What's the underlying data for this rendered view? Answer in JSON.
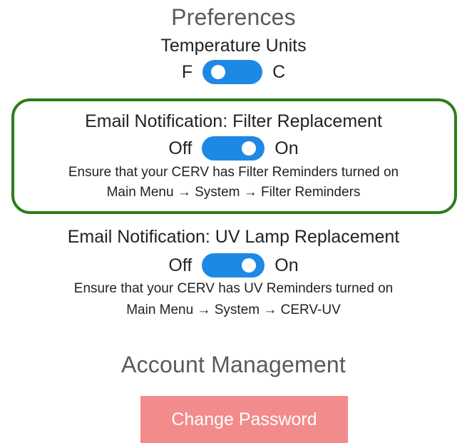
{
  "preferences": {
    "heading": "Preferences",
    "temperature": {
      "label": "Temperature Units",
      "left": "F",
      "right": "C",
      "selected": "F"
    }
  },
  "filter_notification": {
    "label": "Email Notification: Filter Replacement",
    "off": "Off",
    "on": "On",
    "state": "On",
    "hint_line1": "Ensure that your CERV has Filter Reminders turned on",
    "hint_line2": "Main Menu → System → Filter Reminders",
    "highlight_color": "#2e7d1a"
  },
  "uv_notification": {
    "label": "Email Notification: UV Lamp Replacement",
    "off": "Off",
    "on": "On",
    "state": "On",
    "hint_line1": "Ensure that your CERV has UV Reminders turned on",
    "hint_line2": "Main Menu → System → CERV-UV"
  },
  "account": {
    "heading": "Account Management",
    "change_password_label": "Change Password"
  },
  "colors": {
    "toggle": "#1e88e5",
    "button": "#f28b8b",
    "heading": "#5a5a5a"
  }
}
